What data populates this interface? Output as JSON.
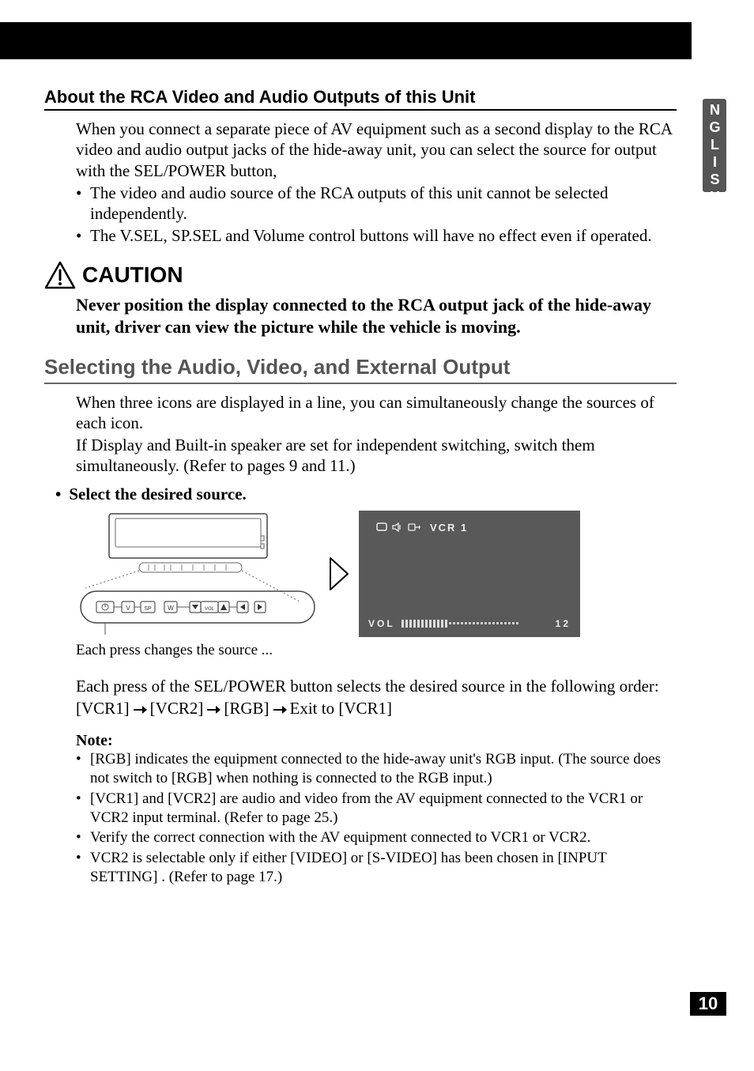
{
  "side_tab": "ENGLISH",
  "page_number": "10",
  "section1": {
    "heading": "About the RCA Video and Audio Outputs of this Unit",
    "para": "When you connect a separate piece of AV equipment such as a second display to the RCA video and audio output jacks of the hide-away unit, you can select the source for output with the SEL/POWER button,",
    "bullets": [
      "The video and audio source of the RCA outputs of this unit cannot be selected independently.",
      "The V.SEL, SP.SEL and Volume control buttons will have no effect even if operated."
    ]
  },
  "caution": {
    "label": "CAUTION",
    "text": "Never position the display connected to the RCA output jack of the hide-away unit, driver can view the picture while the vehicle is moving."
  },
  "section2": {
    "heading": "Selecting the Audio, Video, and External Output",
    "para1": "When three icons are displayed in a line, you can simultaneously change the sources of each icon.",
    "para2": "If Display and Built-in speaker are set for independent switching, switch them simultaneously. (Refer to pages 9 and 11.)",
    "step_bullet": "•",
    "step_text": "Select the desired source.",
    "device_buttons": [
      "V",
      "SP",
      "W",
      "▼",
      "VOL",
      "▲",
      "◄",
      "►"
    ],
    "screen": {
      "source_label": "VCR 1",
      "vol_label": "VOL",
      "vol_value": "12",
      "vol_level": 12,
      "vol_max": 30
    },
    "caption": "Each press changes the source ...",
    "sequence_intro": "Each press of the SEL/POWER button selects the desired source in the following order:",
    "sequence": [
      "[VCR1]",
      "[VCR2]",
      "[RGB]",
      "Exit to [VCR1]"
    ],
    "note_label": "Note:",
    "notes": [
      "[RGB] indicates the equipment connected to the hide-away unit's RGB input. (The source does not switch to [RGB] when nothing is connected to the RGB input.)",
      "[VCR1] and [VCR2] are audio and video from the AV equipment connected to the VCR1 or VCR2 input terminal. (Refer to page 25.)",
      "Verify the correct connection with the AV equipment connected to VCR1 or VCR2.",
      "VCR2 is selectable only if either [VIDEO] or [S-VIDEO] has been chosen in [INPUT SETTING] . (Refer to page 17.)"
    ]
  }
}
